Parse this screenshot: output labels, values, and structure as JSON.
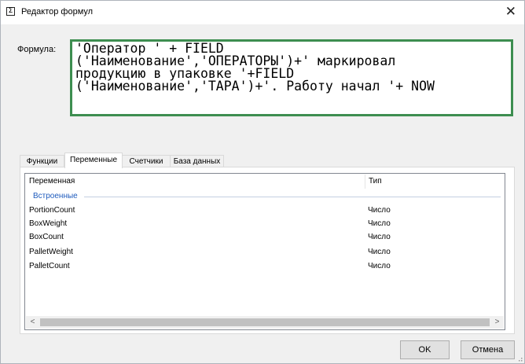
{
  "window": {
    "title": "Редактор формул",
    "icon": "sigma-icon",
    "close_symbol": "✕"
  },
  "formula": {
    "label": "Формула:",
    "text": "'Оператор ' + FIELD\n('Наименование','ОПЕРАТОРЫ')+' маркировал\nпродукцию в упаковке '+FIELD\n('Наименование','ТАРА')+'. Работу начал '+ NOW",
    "border_color": "#3d8e50"
  },
  "tabs": [
    {
      "label": "Функции"
    },
    {
      "label": "Переменные"
    },
    {
      "label": "Счетчики"
    },
    {
      "label": "База данных"
    }
  ],
  "active_tab": "Переменные",
  "list": {
    "columns": [
      "Переменная",
      "Тип"
    ],
    "group": "Встроенные",
    "rows": [
      {
        "name": "PortionCount",
        "type": "Число"
      },
      {
        "name": "BoxWeight",
        "type": "Число"
      },
      {
        "name": "BoxCount",
        "type": "Число"
      },
      {
        "name": "PalletWeight",
        "type": "Число"
      },
      {
        "name": "PalletCount",
        "type": "Число"
      }
    ]
  },
  "scrollbar": {
    "left_arrow": "<",
    "right_arrow": ">"
  },
  "buttons": {
    "ok": "OK",
    "cancel": "Отмена"
  }
}
